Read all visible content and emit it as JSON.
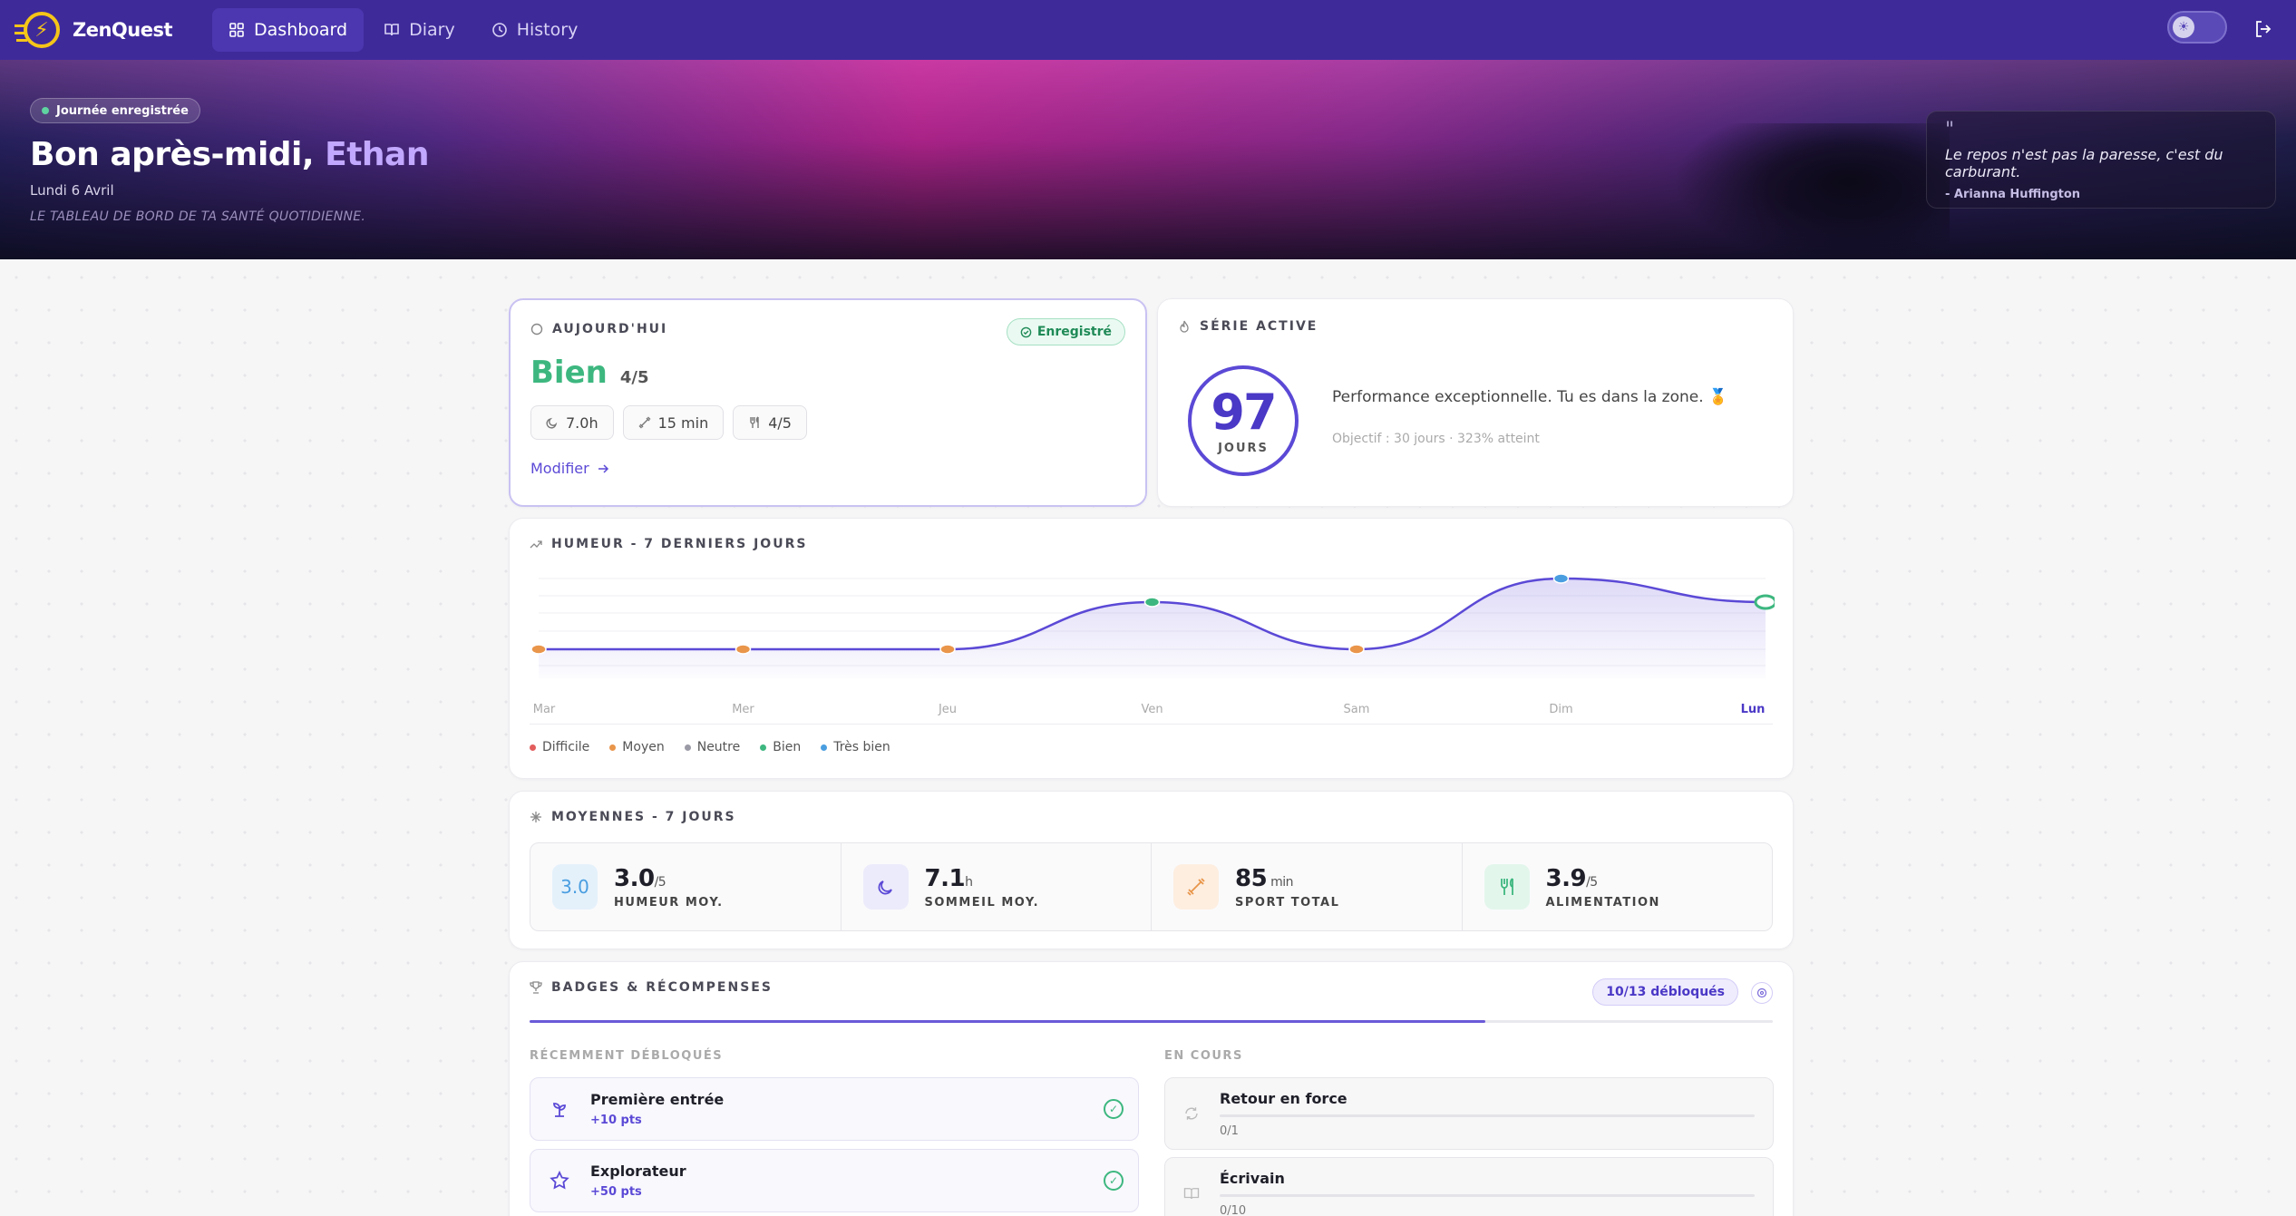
{
  "app": {
    "name": "ZenQuest"
  },
  "nav": {
    "items": [
      {
        "label": "Dashboard",
        "active": true
      },
      {
        "label": "Diary",
        "active": false
      },
      {
        "label": "History",
        "active": false
      }
    ]
  },
  "hero": {
    "badge": "Journée enregistrée",
    "greeting": "Bon après-midi, ",
    "name": "Ethan",
    "date": "Lundi 6 Avril",
    "subtitle": "LE TABLEAU DE BORD DE TA SANTÉ QUOTIDIENNE.",
    "quote": "Le repos n'est pas la paresse, c'est du carburant.",
    "quote_author": "- Arianna Huffington"
  },
  "today": {
    "title": "AUJOURD'HUI",
    "status": "Enregistré",
    "mood": "Bien",
    "score": "4/5",
    "sleep": "7.0h",
    "sport": "15 min",
    "food": "4/5",
    "modify": "Modifier"
  },
  "streak": {
    "title": "SÉRIE ACTIVE",
    "days": "97",
    "unit": "JOURS",
    "message": "Performance exceptionnelle. Tu es dans la zone. 🏅",
    "goal": "Objectif : 30 jours · 323% atteint"
  },
  "mood_chart": {
    "title": "HUMEUR - 7 DERNIERS JOURS",
    "legend": [
      {
        "label": "Difficile",
        "color": "#e35d5d"
      },
      {
        "label": "Moyen",
        "color": "#e9954a"
      },
      {
        "label": "Neutre",
        "color": "#9a9aa6"
      },
      {
        "label": "Bien",
        "color": "#3db77f"
      },
      {
        "label": "Très bien",
        "color": "#4a9ee0"
      }
    ]
  },
  "chart_data": {
    "type": "area",
    "categories": [
      "Mar",
      "Mer",
      "Jeu",
      "Ven",
      "Sam",
      "Dim",
      "Lun"
    ],
    "values": [
      2,
      2,
      2,
      4,
      2,
      5,
      4
    ],
    "point_colors": [
      "#e9954a",
      "#e9954a",
      "#e9954a",
      "#3db77f",
      "#e9954a",
      "#4a9ee0",
      "#3db77f"
    ],
    "highlight_last": true,
    "ylim": [
      0,
      5
    ],
    "line_color": "#5b49d6"
  },
  "averages": {
    "title": "MOYENNES - 7 JOURS",
    "items": [
      {
        "icon_text": "3.0",
        "value": "3.0",
        "unit": "/5",
        "label": "HUMEUR MOY."
      },
      {
        "value": "7.1",
        "unit": "h",
        "label": "SOMMEIL MOY."
      },
      {
        "value": "85",
        "unit": " min",
        "label": "SPORT TOTAL"
      },
      {
        "value": "3.9",
        "unit": "/5",
        "label": "ALIMENTATION"
      }
    ]
  },
  "badges": {
    "title": "BADGES & RÉCOMPENSES",
    "count": "10/13 débloqués",
    "progress": 0.769,
    "recent_title": "RÉCEMMENT DÉBLOQUÉS",
    "progress_title": "EN COURS",
    "recent": [
      {
        "name": "Première entrée",
        "pts": "+10 pts"
      },
      {
        "name": "Explorateur",
        "pts": "+50 pts"
      }
    ],
    "in_progress": [
      {
        "name": "Retour en force",
        "count": "0/1"
      },
      {
        "name": "Écrivain",
        "count": "0/10"
      }
    ]
  }
}
